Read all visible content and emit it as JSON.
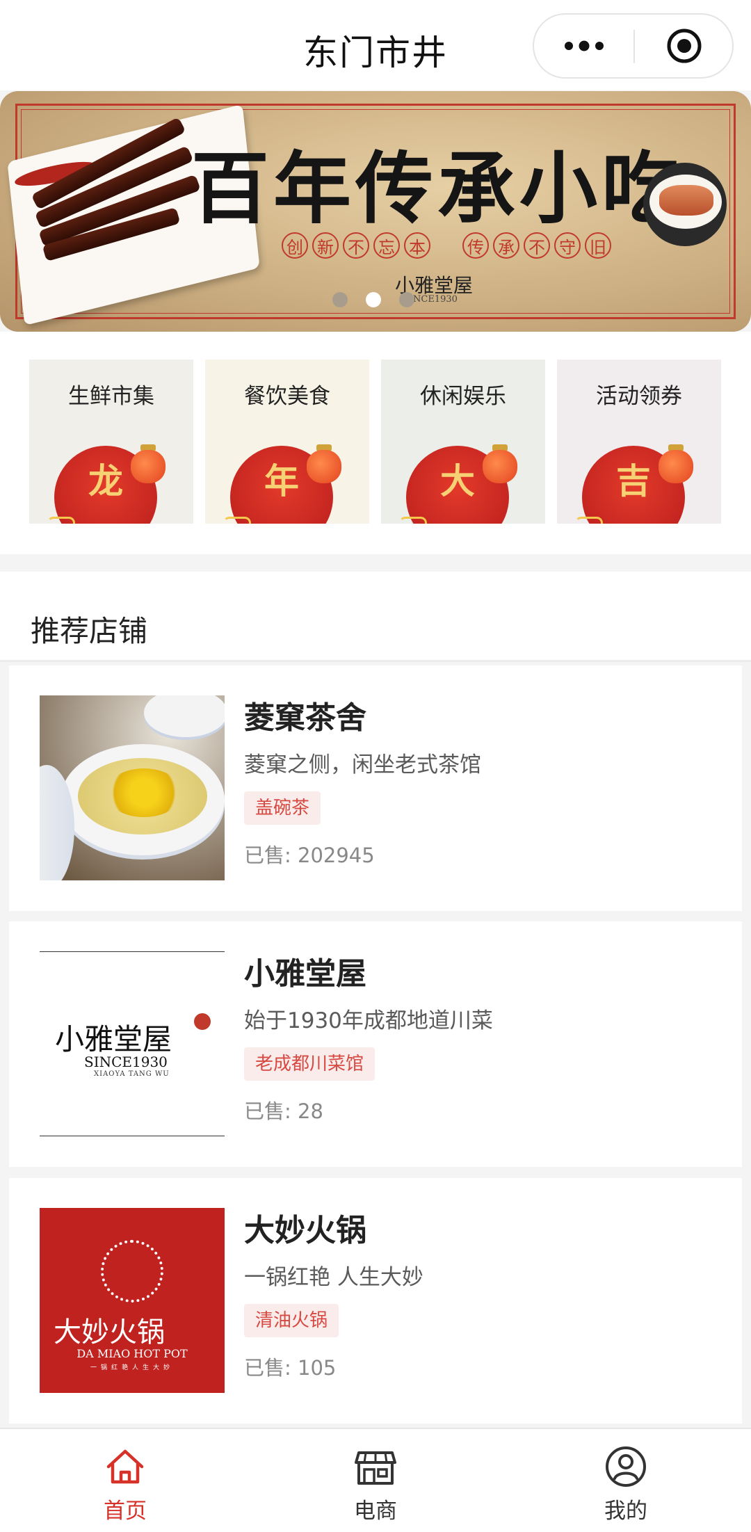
{
  "nav": {
    "title": "东门市井",
    "more_icon": "more-dots-icon",
    "close_icon": "target-circle-icon"
  },
  "banner": {
    "headline": "百年传承小吃",
    "subline_left": [
      "创",
      "新",
      "不",
      "忘",
      "本"
    ],
    "subline_right": [
      "传",
      "承",
      "不",
      "守",
      "旧"
    ],
    "brand": "小雅堂屋",
    "brand_since": "SINCE1930",
    "slide_count": 3,
    "active_slide": 2
  },
  "categories": [
    {
      "label": "生鲜市集",
      "glyph": "龙",
      "bg": "#f1efea"
    },
    {
      "label": "餐饮美食",
      "glyph": "年",
      "bg": "#f7f4e7"
    },
    {
      "label": "休闲娱乐",
      "glyph": "大",
      "bg": "#eceeea"
    },
    {
      "label": "活动领券",
      "glyph": "吉",
      "bg": "#f1ecee"
    }
  ],
  "section": {
    "title": "推荐店铺"
  },
  "stores": [
    {
      "name": "菱窠茶舍",
      "desc": "菱窠之侧，闲坐老式茶馆",
      "tag": "盖碗茶",
      "sold": "已售: 202945"
    },
    {
      "name": "小雅堂屋",
      "desc": "始于1930年成都地道川菜",
      "tag": "老成都川菜馆",
      "sold": "已售: 28",
      "logo_cn": "小雅堂屋",
      "logo_en": "SINCE1930",
      "logo_en2": "XIAOYA TANG WU"
    },
    {
      "name": "大妙火锅",
      "desc": "一锅红艳 人生大妙",
      "tag": "清油火锅",
      "sold": "已售: 105",
      "logo_cn": "大妙火锅",
      "logo_en": "DA MIAO HOT POT",
      "logo_en2": "一锅红艳人生大妙"
    }
  ],
  "tabbar": [
    {
      "label": "首页",
      "icon": "home-icon",
      "active": true
    },
    {
      "label": "电商",
      "icon": "store-icon",
      "active": false
    },
    {
      "label": "我的",
      "icon": "user-icon",
      "active": false
    }
  ],
  "colors": {
    "accent": "#d6322a",
    "tag_bg": "#fbecec",
    "tag_text": "#d64a42"
  }
}
